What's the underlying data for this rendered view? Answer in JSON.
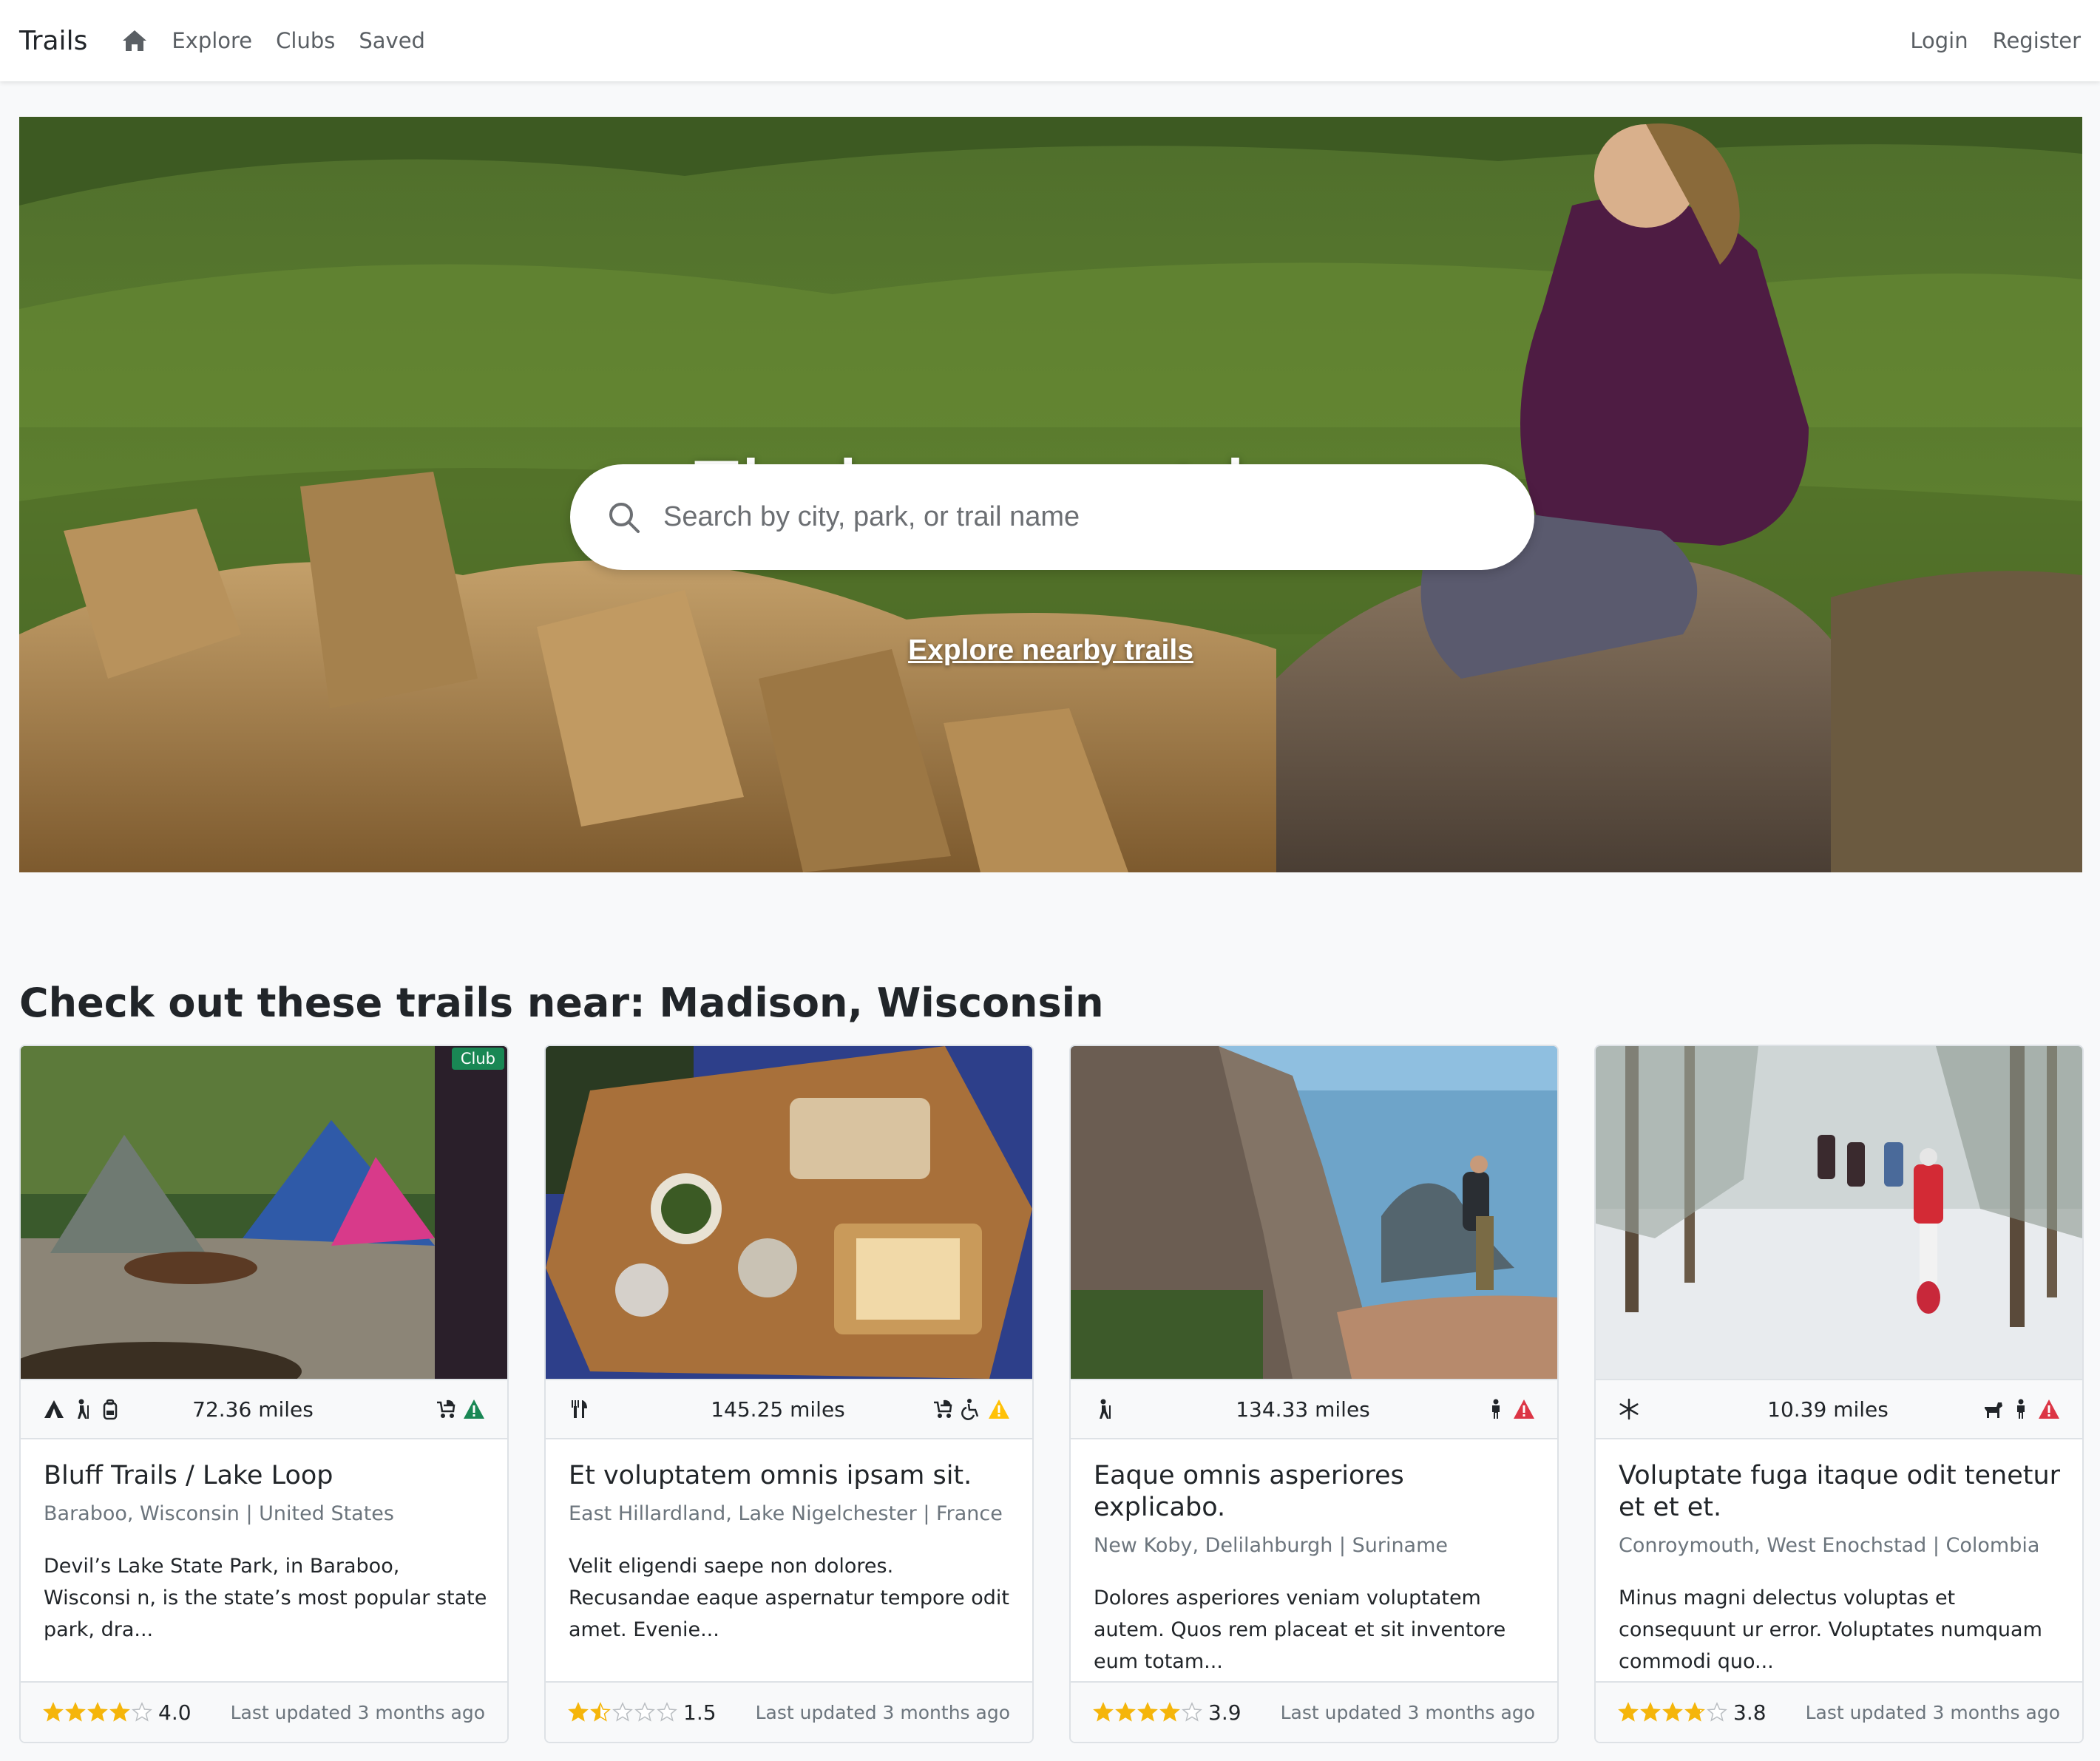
{
  "navbar": {
    "brand": "Trails",
    "home_icon": "home-icon",
    "links": [
      "Explore",
      "Clubs",
      "Saved"
    ],
    "login": "Login",
    "register": "Register"
  },
  "hero": {
    "title": "Find your outdoors",
    "search_placeholder": "Search by city, park, or trail name",
    "search_value": "",
    "explore_link": "Explore nearby trails"
  },
  "section": {
    "title": "Check out these trails near: Madison, Wisconsin"
  },
  "colors": {
    "club_badge": "#198754",
    "star": "#f5b50a",
    "warning_green": "#198754",
    "warning_yellow": "#ffc107",
    "warning_red": "#dc3545"
  },
  "cards": [
    {
      "badge": "Club",
      "miles": "72.36 miles",
      "activity_icons": [
        "camping-icon",
        "hiking-icon",
        "backpack-icon"
      ],
      "feature_icons": [
        "stroller-icon"
      ],
      "alert_icon": "alert-green-icon",
      "title": "Bluff Trails / Lake Loop",
      "location": "Baraboo, Wisconsin | United States",
      "description": "Devil’s Lake State Park, in Baraboo, Wisconsi n, is the state’s most popular state park, dra...",
      "rating": 4.0,
      "rating_text": "4.0",
      "updated": "Last updated 3 months ago"
    },
    {
      "badge": "",
      "miles": "145.25 miles",
      "activity_icons": [
        "utensils-icon"
      ],
      "feature_icons": [
        "stroller-icon",
        "wheelchair-icon"
      ],
      "alert_icon": "alert-yellow-icon",
      "title": "Et voluptatem omnis ipsam sit.",
      "location": "East Hillardland, Lake Nigelchester | France",
      "description": "Velit eligendi saepe non dolores. Recusandae eaque aspernatur tempore odit amet. Evenie...",
      "rating": 1.5,
      "rating_text": "1.5",
      "updated": "Last updated 3 months ago"
    },
    {
      "badge": "",
      "miles": "134.33 miles",
      "activity_icons": [
        "hiking-icon"
      ],
      "feature_icons": [
        "person-icon"
      ],
      "alert_icon": "alert-red-icon",
      "title": "Eaque omnis asperiores explicabo.",
      "location": "New Koby, Delilahburgh | Suriname",
      "description": "Dolores asperiores veniam voluptatem autem. Quos rem placeat et sit inventore eum totam...",
      "rating": 3.9,
      "rating_text": "3.9",
      "updated": "Last updated 3 months ago"
    },
    {
      "badge": "",
      "miles": "10.39 miles",
      "activity_icons": [
        "snowflake-icon"
      ],
      "feature_icons": [
        "dog-icon",
        "person-icon"
      ],
      "alert_icon": "alert-red-icon",
      "title": "Voluptate fuga itaque odit tenetur et et et.",
      "location": "Conroymouth, West Enochstad | Colombia",
      "description": "Minus magni delectus voluptas et consequunt ur error. Voluptates numquam commodi quo...",
      "rating": 3.8,
      "rating_text": "3.8",
      "updated": "Last updated 3 months ago"
    }
  ]
}
